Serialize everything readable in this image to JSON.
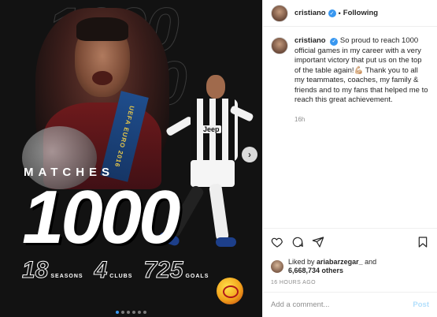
{
  "media": {
    "bg_number": "1000",
    "matches_label": "MATCHES",
    "big_count": "1000",
    "ribbon_text": "UEFA EURO 2016",
    "shirt_text": "Jeep",
    "stats": [
      {
        "num": "18",
        "label": "SEASONS"
      },
      {
        "num": "4",
        "label": "CLUBS"
      },
      {
        "num": "725",
        "label": "GOALS"
      }
    ],
    "carousel": {
      "total": 6,
      "active": 0
    },
    "next_icon": "chevron-right-icon"
  },
  "header": {
    "username": "cristiano",
    "verified_icon": "verified-badge-icon",
    "separator": "•",
    "follow_state": "Following"
  },
  "caption": {
    "username": "cristiano",
    "text": "So proud to reach 1000 official games in my career with a very important victory that put us on the top of the table again!💪🏼 Thank you to all my teammates, coaches, my family & friends and to my fans that helped me to reach this great achievement.",
    "time": "16h"
  },
  "actions": {
    "icons": [
      "heart-icon",
      "comment-icon",
      "share-icon",
      "bookmark-icon"
    ]
  },
  "likes": {
    "prefix": "Liked by",
    "user": "ariabarzegar_",
    "and": "and",
    "others": "6,668,734 others"
  },
  "timeago": "16 HOURS AGO",
  "comment_box": {
    "placeholder": "Add a comment...",
    "post_label": "Post"
  },
  "colors": {
    "accent": "#3897f0",
    "post_disabled": "#b2dffc",
    "media_bg": "#121212"
  }
}
